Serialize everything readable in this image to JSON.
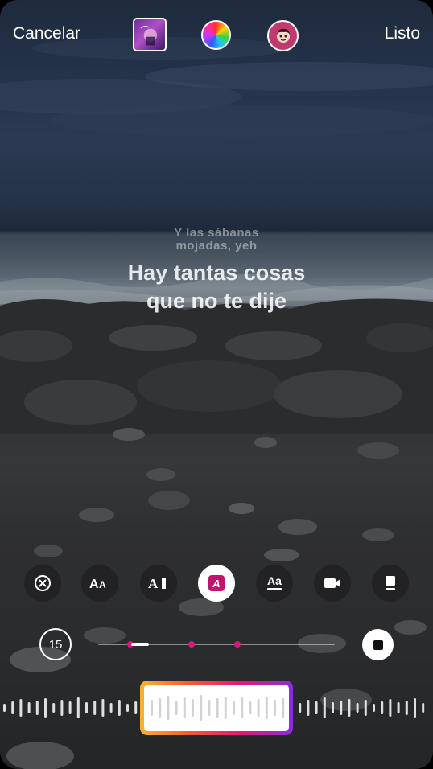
{
  "topbar": {
    "cancel_label": "Cancelar",
    "done_label": "Listo",
    "album_icon": "album-cover-icon",
    "color_icon": "color-wheel-icon",
    "sticker_icon": "face-sticker-icon"
  },
  "lyrics": {
    "previous_line": [
      "Y las sábanas",
      "mojadas, yeh"
    ],
    "current_line": [
      "Hay tantas cosas",
      "que no te dije"
    ]
  },
  "style_toolbar": {
    "items": [
      {
        "name": "remove-icon",
        "label": ""
      },
      {
        "name": "text-size-icon",
        "label": "AA"
      },
      {
        "name": "text-style-icon",
        "label": "A"
      },
      {
        "name": "highlight-style-icon",
        "label": "A",
        "active": true
      },
      {
        "name": "caption-style-icon",
        "label": "Aa"
      },
      {
        "name": "video-clip-icon",
        "label": ""
      },
      {
        "name": "card-style-icon",
        "label": ""
      }
    ]
  },
  "timeline": {
    "duration_label": "15",
    "marker_color": "#d9177e",
    "stop_icon": "stop-icon"
  },
  "colors": {
    "accent_pink": "#e6186f",
    "gradient_start": "#f9b32d",
    "gradient_end": "#8a2be2"
  }
}
